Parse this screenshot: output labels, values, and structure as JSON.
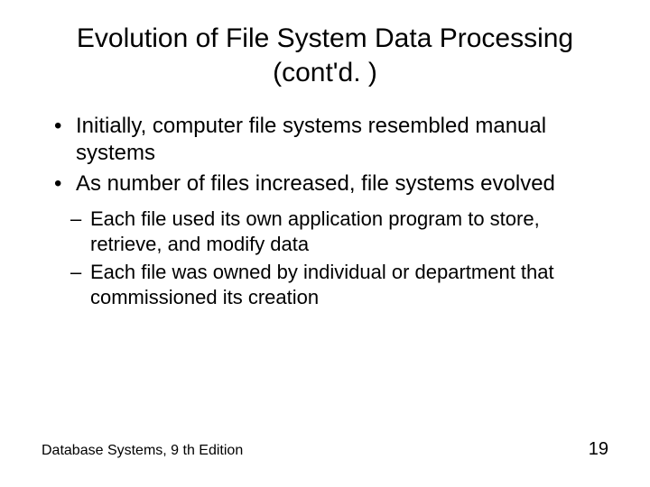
{
  "title": "Evolution of File System Data Processing (cont'd. )",
  "level1": [
    "Initially, computer file systems resembled manual systems",
    "As number of files increased, file systems evolved"
  ],
  "level2": [
    "Each file used its own application program to store, retrieve, and modify data",
    "Each file was owned by individual or department that commissioned its creation"
  ],
  "footer": {
    "left": "Database Systems, 9 th Edition",
    "right": "19"
  }
}
